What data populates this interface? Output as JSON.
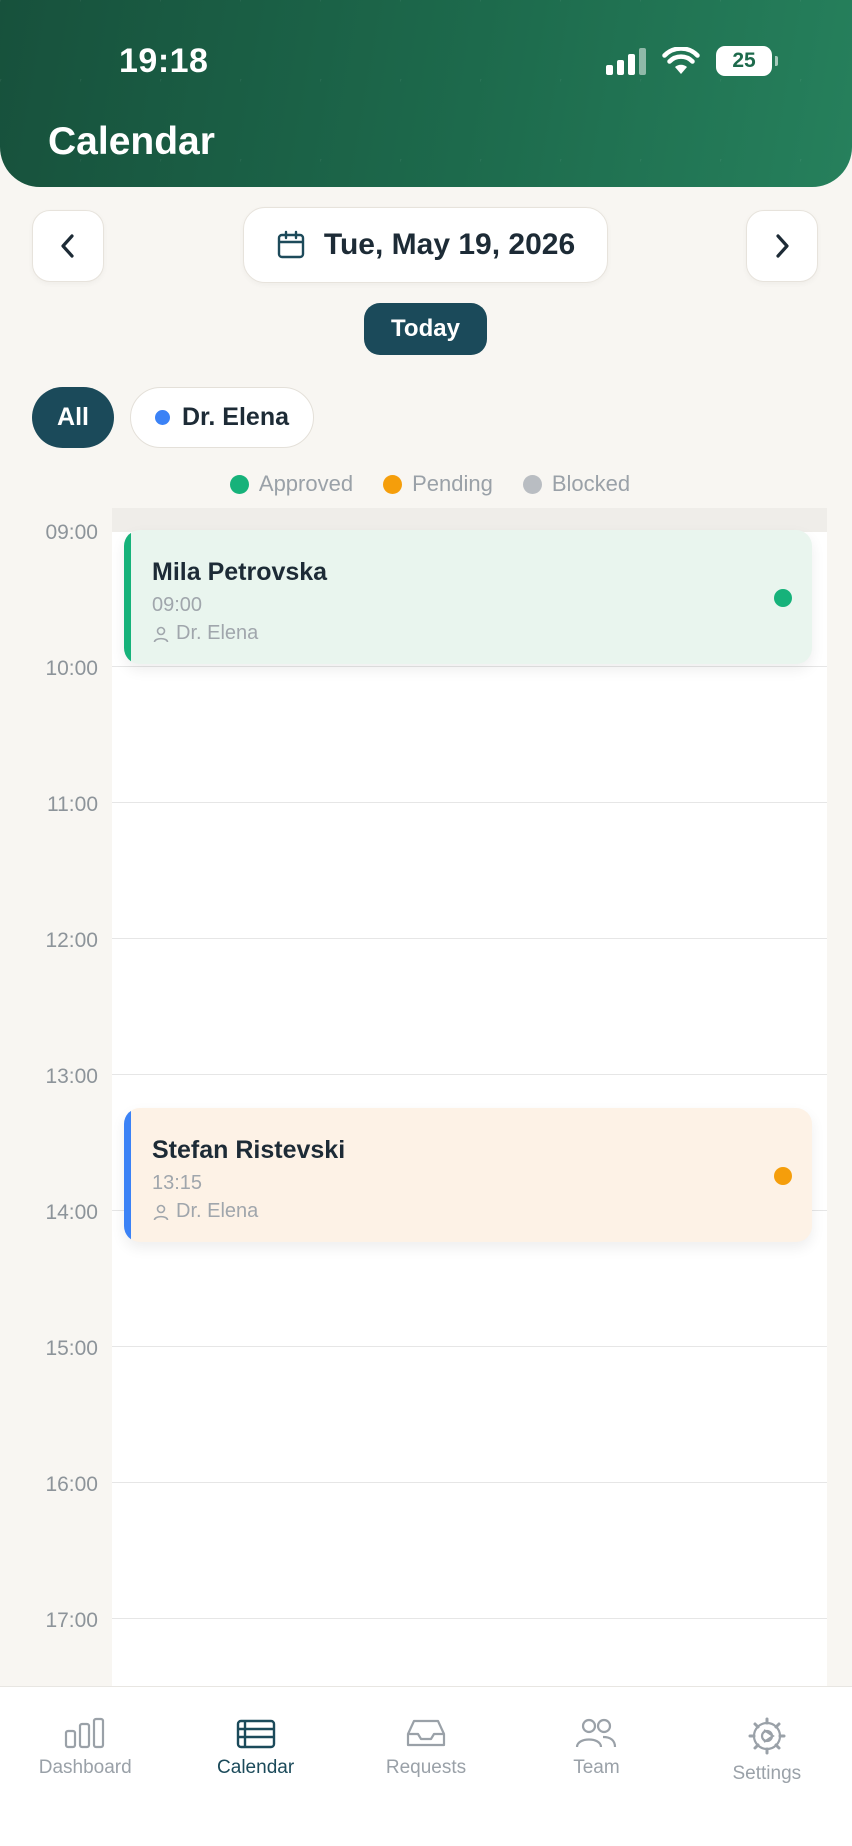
{
  "status_bar": {
    "time": "19:18",
    "battery": "25"
  },
  "header": {
    "title": "Calendar"
  },
  "date_nav": {
    "date": "Tue, May 19, 2026",
    "today_label": "Today"
  },
  "filters": {
    "all_label": "All",
    "doctor_label": "Dr. Elena",
    "doctor_color": "#3b82f6"
  },
  "legend": [
    {
      "label": "Approved",
      "color": "#16b27a"
    },
    {
      "label": "Pending",
      "color": "#f59e0b"
    },
    {
      "label": "Blocked",
      "color": "#b9bdc2"
    }
  ],
  "hours": [
    "09:00",
    "10:00",
    "11:00",
    "12:00",
    "13:00",
    "14:00",
    "15:00",
    "16:00",
    "17:00"
  ],
  "appointments": [
    {
      "name": "Mila Petrovska",
      "time": "09:00",
      "doctor": "Dr. Elena",
      "status": "Approved",
      "bar_color": "#16b27a",
      "bg": "#e9f5ee",
      "status_color": "#16b27a"
    },
    {
      "name": "Stefan Ristevski",
      "time": "13:15",
      "doctor": "Dr. Elena",
      "status": "Pending",
      "bar_color": "#3b82f6",
      "bg": "#fdf2e6",
      "status_color": "#f59e0b"
    }
  ],
  "bottom_nav": [
    {
      "label": "Dashboard",
      "icon": "bar-chart-icon",
      "active": false
    },
    {
      "label": "Calendar",
      "icon": "calendar-list-icon",
      "active": true
    },
    {
      "label": "Requests",
      "icon": "inbox-icon",
      "active": false
    },
    {
      "label": "Team",
      "icon": "people-icon",
      "active": false
    },
    {
      "label": "Settings",
      "icon": "gear-icon",
      "active": false
    }
  ],
  "colors": {
    "header_green": "#1d6a4c",
    "primary_dark": "#1b4a5a"
  }
}
